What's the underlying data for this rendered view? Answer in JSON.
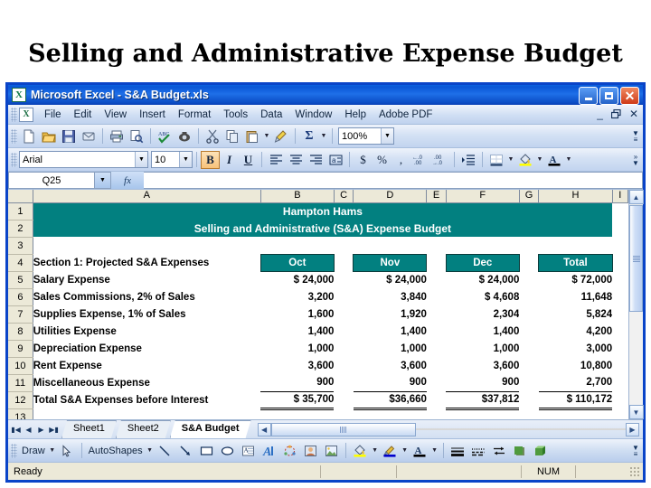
{
  "slide": {
    "title": "Selling and Administrative Expense Budget"
  },
  "window": {
    "title": "Microsoft Excel - S&A Budget.xls",
    "logo_icon": "excel-logo-icon",
    "buttons": {
      "minimize": "minimize-icon",
      "maximize": "maximize-icon",
      "close": "close-icon"
    },
    "doc_buttons": {
      "minimize": "_",
      "restore": "restore-icon",
      "close": "✕"
    }
  },
  "menubar": {
    "items": [
      "File",
      "Edit",
      "View",
      "Insert",
      "Format",
      "Tools",
      "Data",
      "Window",
      "Help",
      "Adobe PDF"
    ]
  },
  "standard_toolbar": {
    "zoom_value": "100%",
    "buttons": [
      "new-icon",
      "open-icon",
      "save-icon",
      "permission-icon",
      "print-icon",
      "print-preview-icon",
      "spelling-icon",
      "research-icon",
      "cut-icon",
      "copy-icon",
      "paste-icon",
      "format-painter-icon",
      "autosum-icon"
    ]
  },
  "formatting_toolbar": {
    "font_name": "Arial",
    "font_size": "10",
    "bold_label": "B",
    "italic_label": "I",
    "underline_label": "U",
    "currency_label": "$",
    "percent_label": "%",
    "comma_label": ",",
    "bold_active": true,
    "buttons": [
      "align-left-icon",
      "align-center-icon",
      "align-right-icon",
      "merge-center-icon",
      "increase-decimal-icon",
      "decrease-decimal-icon",
      "increase-indent-icon",
      "borders-icon",
      "fill-color-icon",
      "font-color-icon"
    ]
  },
  "formula_bar": {
    "name_box": "Q25",
    "fx_label": "fx",
    "formula_value": ""
  },
  "sheet": {
    "columns": [
      "A",
      "B",
      "C",
      "D",
      "E",
      "F",
      "G",
      "H",
      "I"
    ],
    "rows": [
      "1",
      "2",
      "3",
      "4",
      "5",
      "6",
      "7",
      "8",
      "9",
      "10",
      "11",
      "12",
      "13"
    ],
    "banner_line1": "Hampton Hams",
    "banner_line2": "Selling and Administrative (S&A) Expense Budget",
    "section_label": "Section 1: Projected S&A Expenses",
    "month_headers": [
      "Oct",
      "Nov",
      "Dec",
      "Total"
    ],
    "line_items": [
      {
        "label": "Salary Expense",
        "oct": "$ 24,000",
        "nov": "$ 24,000",
        "dec": "$ 24,000",
        "total": "$   72,000"
      },
      {
        "label": "Sales Commissions, 2% of Sales",
        "oct": "3,200",
        "nov": "3,840",
        "dec": "$  4,608",
        "total": "11,648"
      },
      {
        "label": "Supplies Expense, 1% of Sales",
        "oct": "1,600",
        "nov": "1,920",
        "dec": "2,304",
        "total": "5,824"
      },
      {
        "label": "Utilities Expense",
        "oct": "1,400",
        "nov": "1,400",
        "dec": "1,400",
        "total": "4,200"
      },
      {
        "label": "Depreciation Expense",
        "oct": "1,000",
        "nov": "1,000",
        "dec": "1,000",
        "total": "3,000"
      },
      {
        "label": "Rent Expense",
        "oct": "3,600",
        "nov": "3,600",
        "dec": "3,600",
        "total": "10,800"
      },
      {
        "label": "Miscellaneous Expense",
        "oct": "900",
        "nov": "900",
        "dec": "900",
        "total": "2,700"
      }
    ],
    "total_row": {
      "label": "Total S&A Expenses before Interest",
      "oct": "$ 35,700",
      "nov": "$36,660",
      "dec": "$37,812",
      "total": "$ 110,172"
    },
    "colors": {
      "banner_fill": "#028080",
      "banner_text": "#ffffff",
      "header_fill": "#028080"
    }
  },
  "tabbar": {
    "nav_first": "▮◀",
    "nav_prev": "◀",
    "nav_next": "▶",
    "nav_last": "▶▮",
    "tabs": [
      {
        "label": "Sheet1",
        "active": false
      },
      {
        "label": "Sheet2",
        "active": false
      },
      {
        "label": "S&A Budget",
        "active": true
      }
    ]
  },
  "drawing_toolbar": {
    "draw_label": "Draw",
    "autoshapes_label": "AutoShapes",
    "buttons": [
      "select-objects-icon",
      "line-icon",
      "arrow-icon",
      "rectangle-icon",
      "oval-icon",
      "text-box-icon",
      "wordart-icon",
      "diagram-icon",
      "clip-art-icon",
      "picture-icon",
      "fill-color-icon",
      "line-color-icon",
      "font-color-icon",
      "line-style-icon",
      "dash-style-icon",
      "arrow-style-icon",
      "shadow-style-icon",
      "3d-style-icon"
    ]
  },
  "statusbar": {
    "status": "Ready",
    "num_lock": "NUM"
  }
}
